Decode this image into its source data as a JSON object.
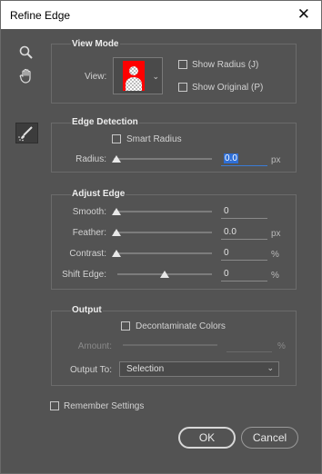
{
  "window": {
    "title": "Refine Edge"
  },
  "view_mode": {
    "title": "View Mode",
    "view_label": "View:",
    "show_radius": "Show Radius (J)",
    "show_original": "Show Original (P)"
  },
  "edge_detection": {
    "title": "Edge Detection",
    "smart_radius": "Smart Radius",
    "radius_label": "Radius:",
    "radius_value": "0.0",
    "radius_unit": "px"
  },
  "adjust_edge": {
    "title": "Adjust Edge",
    "smooth_label": "Smooth:",
    "smooth_value": "0",
    "feather_label": "Feather:",
    "feather_value": "0.0",
    "feather_unit": "px",
    "contrast_label": "Contrast:",
    "contrast_value": "0",
    "contrast_unit": "%",
    "shift_label": "Shift Edge:",
    "shift_value": "0",
    "shift_unit": "%"
  },
  "output": {
    "title": "Output",
    "decontaminate": "Decontaminate Colors",
    "amount_label": "Amount:",
    "amount_unit": "%",
    "output_to_label": "Output To:",
    "output_to_value": "Selection"
  },
  "remember_settings": "Remember Settings",
  "buttons": {
    "ok": "OK",
    "cancel": "Cancel"
  },
  "icons": {
    "zoom": "zoom-tool-icon",
    "hand": "hand-tool-icon",
    "refine_brush": "refine-radius-brush-icon",
    "close": "close-icon"
  },
  "colors": {
    "preview_red": "#ff0000",
    "accent_blue": "#2f6fd6"
  }
}
